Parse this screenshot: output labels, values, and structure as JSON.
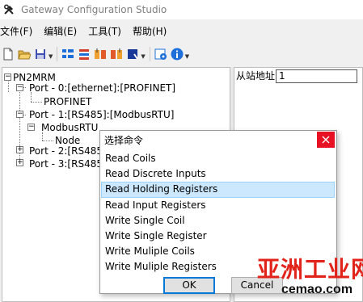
{
  "window": {
    "title": "Gateway Configuration Studio"
  },
  "menu": [
    "文件(F)",
    "编辑(E)",
    "工具(T)",
    "帮助(H)"
  ],
  "toolbar": {
    "buttons": [
      "new-file-icon",
      "open-folder-icon",
      "save-icon",
      "add-port-icon",
      "add-device-icon",
      "import-icon",
      "export-icon",
      "download-icon",
      "settings-icon",
      "info-icon"
    ]
  },
  "tree": {
    "root": "PN2MRM",
    "port0": "Port - 0:[ethernet]:[PROFINET]",
    "port0_child": "PROFINET",
    "port1": "Port - 1:[RS485]:[ModbusRTU]",
    "port1_child": "ModbusRTU",
    "port1_node": "Node",
    "port2": "Port - 2:[RS485",
    "port3": "Port - 3:[RS485"
  },
  "properties": {
    "slave_address_label": "从站地址",
    "slave_address_value": "1"
  },
  "dialog": {
    "title": "选择命令",
    "commands": [
      "Read Coils",
      "Read Discrete Inputs",
      "Read Holding Registers",
      "Read Input Registers",
      "Write Single Coil",
      "Write Single Register",
      "Write Muliple Coils",
      "Write Muliple Registers"
    ],
    "selected_index": 2,
    "ok_label": "OK",
    "cancel_label": "Cancel"
  },
  "watermark": {
    "title": "亚洲工业网",
    "url": "cemao.com"
  },
  "colors": {
    "selection": "#cce8ff",
    "close": "#e81123",
    "watermark": "#e2231a"
  }
}
